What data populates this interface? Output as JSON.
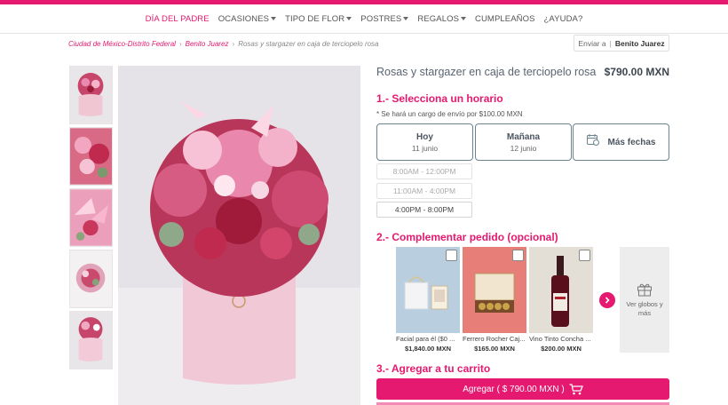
{
  "nav": {
    "items": [
      {
        "label": "DÍA DEL PADRE",
        "dropdown": false,
        "active": true
      },
      {
        "label": "OCASIONES",
        "dropdown": true,
        "active": false
      },
      {
        "label": "TIPO DE FLOR",
        "dropdown": true,
        "active": false
      },
      {
        "label": "POSTRES",
        "dropdown": true,
        "active": false
      },
      {
        "label": "REGALOS",
        "dropdown": true,
        "active": false
      },
      {
        "label": "CUMPLEAÑOS",
        "dropdown": false,
        "active": false
      },
      {
        "label": "¿AYUDA?",
        "dropdown": false,
        "active": false
      }
    ]
  },
  "breadcrumb": {
    "items": [
      "Ciudad de México-Distrito Federal",
      "Benito Juarez",
      "Rosas y stargazer en caja de terciopelo rosa"
    ]
  },
  "send_to": {
    "label": "Enviar a",
    "city": "Benito Juarez"
  },
  "product": {
    "title": "Rosas y stargazer en caja de terciopelo rosa",
    "price": "$790.00 MXN"
  },
  "step1": {
    "title": "1.- Selecciona un horario",
    "note": "* Se hará un cargo de envío por $100.00 MXN",
    "dates": [
      {
        "day": "Hoy",
        "date": "11 junio"
      },
      {
        "day": "Mañana",
        "date": "12 junio"
      }
    ],
    "more_dates": "Más fechas",
    "slots": [
      {
        "label": "8:00AM - 12:00PM",
        "enabled": false
      },
      {
        "label": "11:00AM - 4:00PM",
        "enabled": false
      },
      {
        "label": "4:00PM - 8:00PM",
        "enabled": true
      }
    ]
  },
  "step2": {
    "title": "2.- Complementar pedido (opcional)",
    "addons": [
      {
        "name": "Facial para él ($0 ...",
        "price": "$1,840.00 MXN"
      },
      {
        "name": "Ferrero Rocher Caj...",
        "price": "$165.00 MXN"
      },
      {
        "name": "Vino Tinto Concha ...",
        "price": "$200.00 MXN"
      }
    ],
    "see_more": "Ver globos y más"
  },
  "step3": {
    "title": "3.- Agregar a tu carrito",
    "button": "Agregar ( $ 790.00 MXN )"
  },
  "colors": {
    "accent": "#e5196f",
    "border": "#6a8390",
    "text": "#4a5560"
  },
  "icons": [
    "chevron-down-icon",
    "calendar-icon",
    "chevron-right-icon",
    "gift-icon",
    "cart-icon"
  ]
}
